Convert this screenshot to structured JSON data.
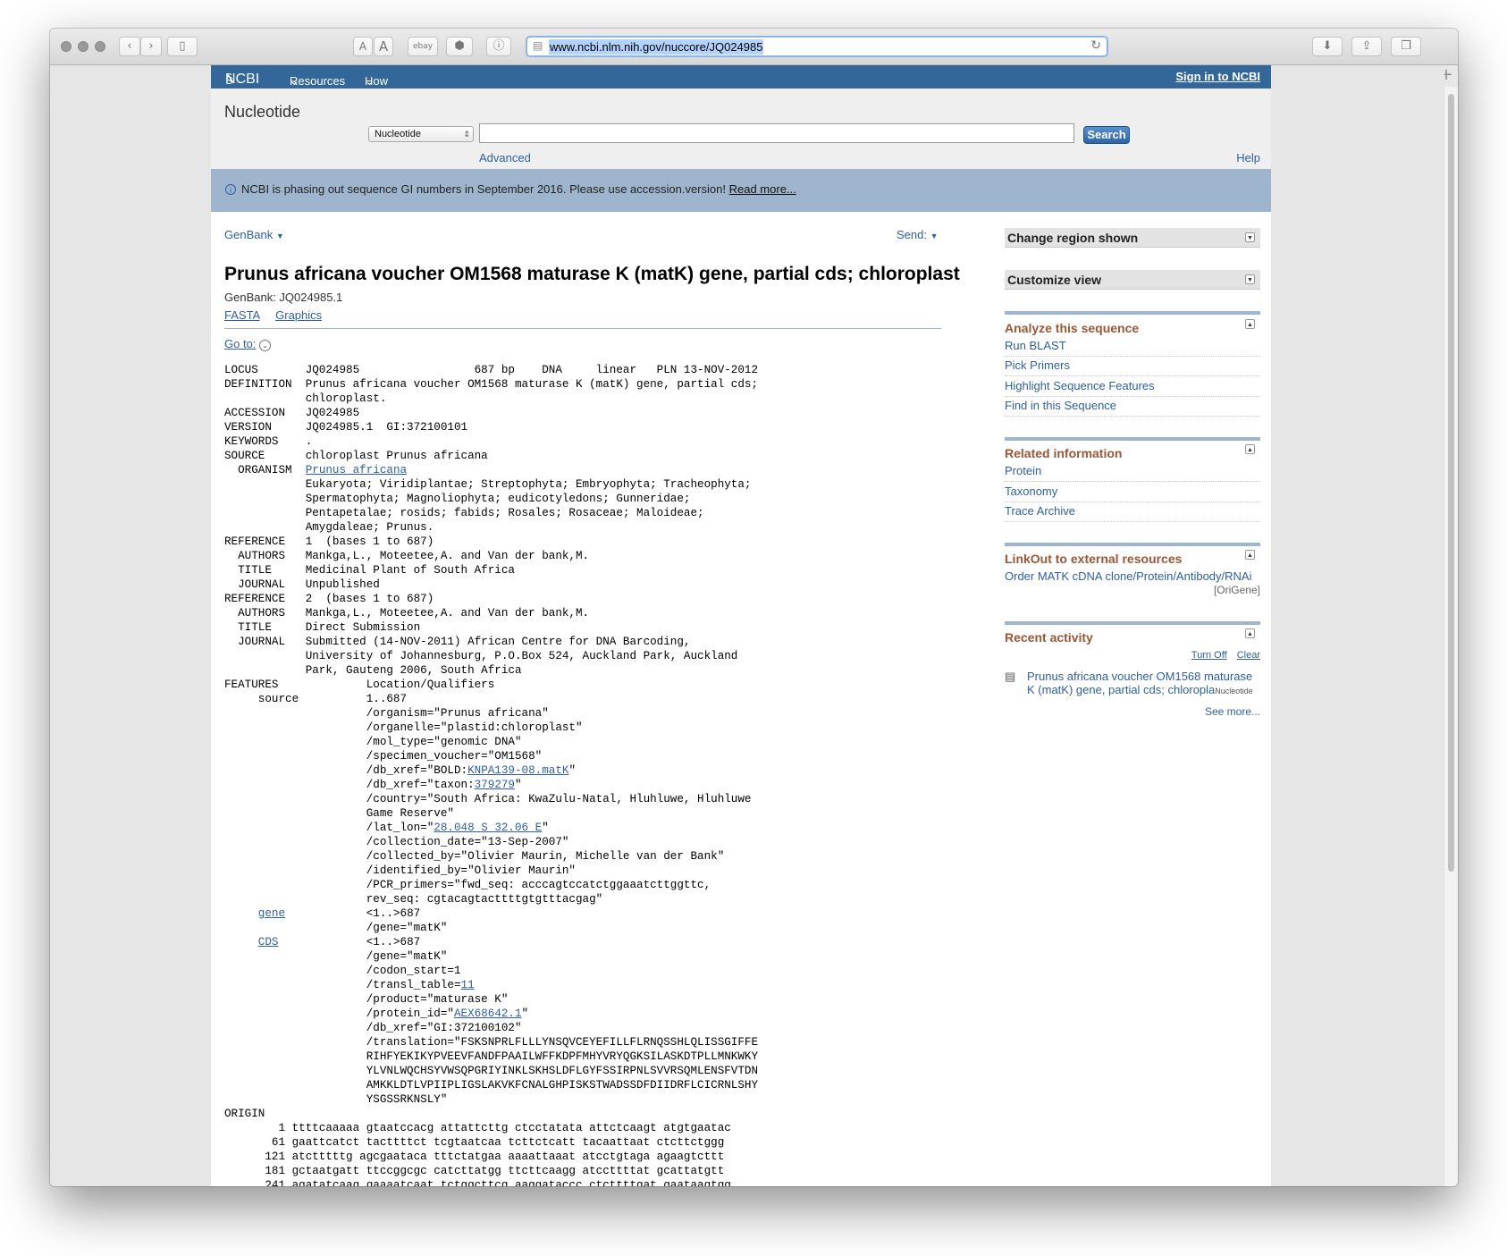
{
  "browser": {
    "url": "www.ncbi.nlm.nih.gov/nuccore/JQ024985",
    "font_small_label": "A",
    "font_large_label": "A",
    "ebay_label": "ebay"
  },
  "ncbi_bar": {
    "logo": "NCBI",
    "resources": "Resources",
    "howto": "How To",
    "signin": "Sign in to NCBI"
  },
  "search": {
    "db_title": "Nucleotide",
    "db_selected": "Nucleotide",
    "query": "",
    "button": "Search",
    "advanced": "Advanced",
    "help": "Help"
  },
  "notice": {
    "text": "NCBI is phasing out sequence GI numbers in September 2016. Please use accession.version!",
    "link": "Read more..."
  },
  "record": {
    "format": "GenBank",
    "send": "Send:",
    "title": "Prunus africana voucher OM1568 maturase K (matK) gene, partial cds; chloroplast",
    "accession_line": "GenBank: JQ024985.1",
    "fasta": "FASTA",
    "graphics": "Graphics",
    "goto": "Go to:"
  },
  "flatfile": {
    "header": [
      "LOCUS       JQ024985                 687 bp    DNA     linear   PLN 13-NOV-2012",
      "DEFINITION  Prunus africana voucher OM1568 maturase K (matK) gene, partial cds;",
      "            chloroplast.",
      "ACCESSION   JQ024985",
      "VERSION     JQ024985.1  GI:372100101",
      "KEYWORDS    .",
      "SOURCE      chloroplast Prunus africana"
    ],
    "organism_label": "  ORGANISM  ",
    "organism_link": "Prunus africana",
    "lineage": [
      "            Eukaryota; Viridiplantae; Streptophyta; Embryophyta; Tracheophyta;",
      "            Spermatophyta; Magnoliophyta; eudicotyledons; Gunneridae;",
      "            Pentapetalae; rosids; fabids; Rosales; Rosaceae; Maloideae;",
      "            Amygdaleae; Prunus.",
      "REFERENCE   1  (bases 1 to 687)",
      "  AUTHORS   Mankga,L., Moteetee,A. and Van der bank,M.",
      "  TITLE     Medicinal Plant of South Africa",
      "  JOURNAL   Unpublished",
      "REFERENCE   2  (bases 1 to 687)",
      "  AUTHORS   Mankga,L., Moteetee,A. and Van der bank,M.",
      "  TITLE     Direct Submission",
      "  JOURNAL   Submitted (14-NOV-2011) African Centre for DNA Barcoding,",
      "            University of Johannesburg, P.O.Box 524, Auckland Park, Auckland",
      "            Park, Gauteng 2006, South Africa",
      "FEATURES             Location/Qualifiers",
      "     source          1..687",
      "                     /organism=\"Prunus africana\"",
      "                     /organelle=\"plastid:chloroplast\"",
      "                     /mol_type=\"genomic DNA\"",
      "                     /specimen_voucher=\"OM1568\""
    ],
    "bold_prefix": "                     /db_xref=\"BOLD:",
    "bold_link": "KNPA139-08.matK",
    "taxon_prefix": "                     /db_xref=\"taxon:",
    "taxon_link": "379279",
    "country": [
      "                     /country=\"South Africa: KwaZulu-Natal, Hluhluwe, Hluhluwe",
      "                     Game Reserve\""
    ],
    "latlon_prefix": "                     /lat_lon=\"",
    "latlon_link": "28.048 S 32.06 E",
    "collection": [
      "                     /collection_date=\"13-Sep-2007\"",
      "                     /collected_by=\"Olivier Maurin, Michelle van der Bank\"",
      "                     /identified_by=\"Olivier Maurin\"",
      "                     /PCR_primers=\"fwd_seq: acccagtccatctggaaatcttggttc,",
      "                     rev_seq: cgtacagtacttttgtgtttacgag\""
    ],
    "gene_link": "gene",
    "gene_loc": "            <1..>687",
    "gene_q": "                     /gene=\"matK\"",
    "cds_link": "CDS",
    "cds_loc": "             <1..>687",
    "cds_q": [
      "                     /gene=\"matK\"",
      "                     /codon_start=1"
    ],
    "transl_prefix": "                     /transl_table=",
    "transl_link": "11",
    "product": "                     /product=\"maturase K\"",
    "protein_prefix": "                     /protein_id=\"",
    "protein_link": "AEX68642.1",
    "translation": [
      "                     /db_xref=\"GI:372100102\"",
      "                     /translation=\"FSKSNPRLFLLLYNSQVCEYEFILLFLRNQSSHLQLISSGIFFE",
      "                     RIHFYEKIKYPVEEVFANDFPAAILWFFKDPFMHYVRYQGKSILASKDTPLLMNKWKY",
      "                     YLVNLWQCHSYVWSQPGRIYINKLSKHSLDFLGYFSSIRPNLSVVRSQMLENSFVTDN",
      "                     AMKKLDTLVPIIPLIGSLAKVKFCNALGHPISKSTWADSSDFDIIDRFLCICRNLSHY",
      "                     YSGSSRKNSLY\"",
      "ORIGIN",
      "        1 ttttcaaaaa gtaatccacg attattcttg ctcctatata attctcaagt atgtgaatac",
      "       61 gaattcatct tacttttct tcgtaatcaa tcttctcatt tacaattaat ctcttctggg",
      "      121 atctttttg agcgaataca tttctatgaa aaaattaaat atcctgtaga agaagtcttt",
      "      181 gctaatgatt ttccggcgc catcttatgg ttcttcaagg atccttttat gcattatgtt",
      "      241 agatatcaag gaaaatcaat tctggcttcg aaggataccc ctcttttgat gaataagtgg"
    ]
  },
  "sidebar": {
    "change_region": "Change region shown",
    "customize_view": "Customize view",
    "analyze_title": "Analyze this sequence",
    "analyze_links": [
      "Run BLAST",
      "Pick Primers",
      "Highlight Sequence Features",
      "Find in this Sequence"
    ],
    "related_title": "Related information",
    "related_links": [
      "Protein",
      "Taxonomy",
      "Trace Archive"
    ],
    "linkout_title": "LinkOut to external resources",
    "linkout_link": "Order MATK cDNA clone/Protein/Antibody/RNAi",
    "linkout_source": "[OriGene]",
    "recent_title": "Recent activity",
    "turn_off": "Turn Off",
    "clear": "Clear",
    "recent_item_line1": "Prunus africana voucher OM1568 maturase",
    "recent_item_line2": "K (matK) gene, partial cds; chloropla",
    "recent_item_db": "Nucleotide",
    "see_more": "See more..."
  },
  "colors": {
    "ncbi_blue": "#336699",
    "notice_bg": "#9fb5cd",
    "link": "#2f5f9f",
    "section_title": "#985735"
  }
}
